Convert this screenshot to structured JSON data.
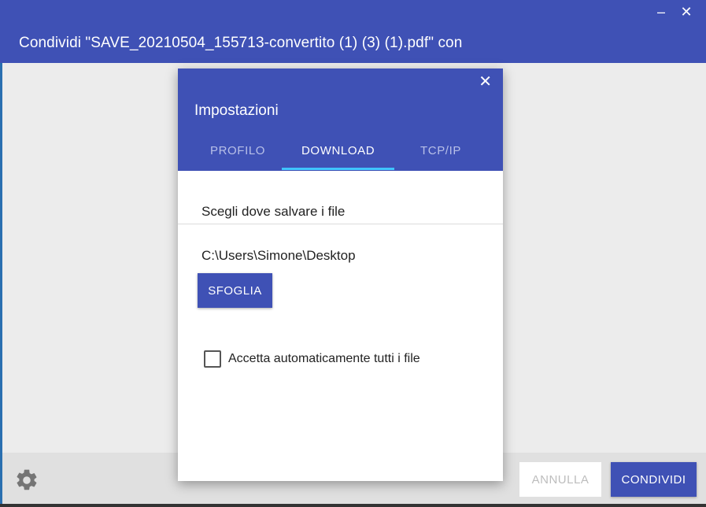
{
  "window": {
    "title": "Condividi \"SAVE_20210504_155713-convertito (1) (3) (1).pdf\" con",
    "minimize_glyph": "–",
    "close_glyph": "✕"
  },
  "dialog": {
    "close_glyph": "✕",
    "title": "Impostazioni",
    "tabs": [
      {
        "label": "PROFILO",
        "active": false
      },
      {
        "label": "DOWNLOAD",
        "active": true
      },
      {
        "label": "TCP/IP",
        "active": false
      }
    ],
    "section_label": "Scegli dove salvare i file",
    "path": "C:\\Users\\Simone\\Desktop",
    "browse_label": "SFOGLIA",
    "auto_accept_label": "Accetta automaticamente tutti i file",
    "auto_accept_checked": false
  },
  "footer": {
    "settings_icon": "gear-icon",
    "cancel_label": "ANNULLA",
    "share_label": "CONDIVIDI"
  },
  "colors": {
    "primary": "#3f51b5",
    "tab_indicator": "#40c4ff",
    "background": "#ececec"
  }
}
